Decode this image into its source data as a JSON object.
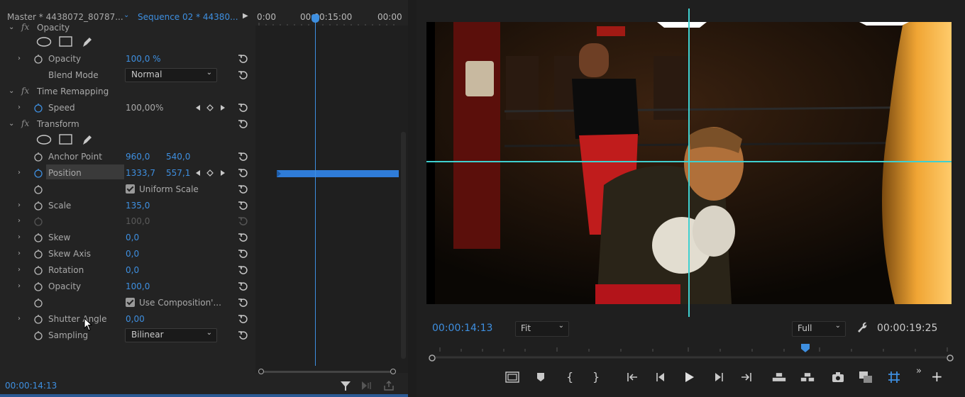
{
  "effect_controls": {
    "source_tab": "Master * 4438072_80787...",
    "sequence_tab": "Sequence 02 * 44380...",
    "timecodes": [
      "0:00",
      "00:00:15:00",
      "00:00"
    ],
    "current_time": "00:00:14:13",
    "opacity_section": {
      "header": "Opacity",
      "opacity_label": "Opacity",
      "opacity_value": "100,0 %",
      "blend_mode_label": "Blend Mode",
      "blend_mode_value": "Normal"
    },
    "time_remapping": {
      "header": "Time Remapping",
      "speed_label": "Speed",
      "speed_value": "100,00%"
    },
    "transform": {
      "header": "Transform",
      "anchor_label": "Anchor Point",
      "anchor_x": "960,0",
      "anchor_y": "540,0",
      "position_label": "Position",
      "position_x": "1333,7",
      "position_y": "557,1",
      "uniform_scale_label": "Uniform Scale",
      "scale_label": "Scale",
      "scale_value": "135,0",
      "scale_width_value": "100,0",
      "skew_label": "Skew",
      "skew_value": "0,0",
      "skew_axis_label": "Skew Axis",
      "skew_axis_value": "0,0",
      "rotation_label": "Rotation",
      "rotation_value": "0,0",
      "opacity_label": "Opacity",
      "opacity_value": "100,0",
      "use_comp_label": "Use Composition'...",
      "shutter_label": "Shutter Angle",
      "shutter_value": "0,00",
      "sampling_label": "Sampling",
      "sampling_value": "Bilinear"
    }
  },
  "program_monitor": {
    "current_time": "00:00:14:13",
    "fit_value": "Fit",
    "quality_value": "Full",
    "duration": "00:00:19:25"
  },
  "colors": {
    "accent": "#3e8fe0",
    "guide": "#3fd0d0",
    "panel": "#232323"
  }
}
